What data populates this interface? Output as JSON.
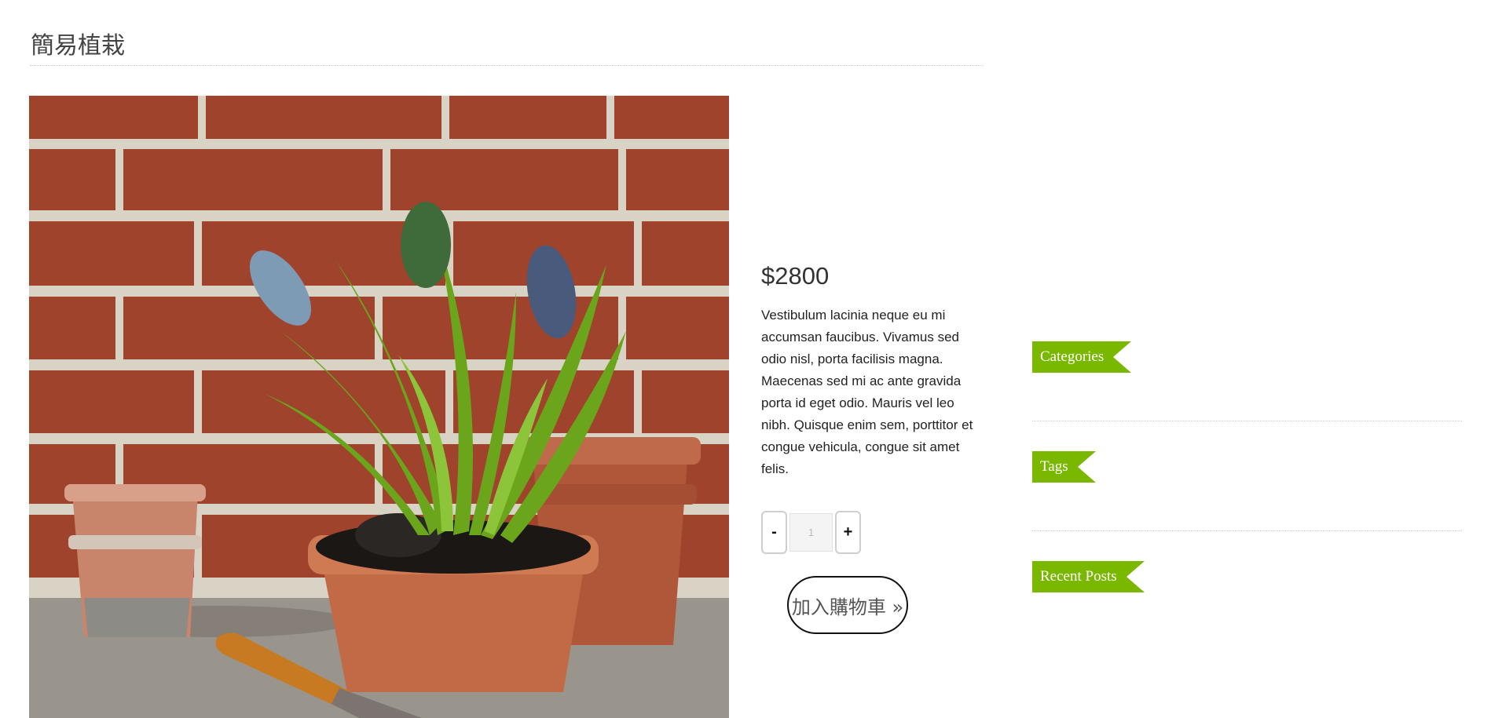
{
  "product": {
    "title": "簡易植栽",
    "image_description_icon": "potted-hyacinth-photo",
    "price": "$2800",
    "description": "Vestibulum lacinia neque eu mi accumsan faucibus. Vivamus sed odio nisl, porta facilisis magna. Maecenas sed mi ac ante gravida porta id eget odio. Mauris vel leo nibh. Quisque enim sem, porttitor et congue vehicula, congue sit amet felis.",
    "quantity": {
      "minus_label": "-",
      "plus_label": "+",
      "value": "1"
    },
    "add_to_cart_label": "加入購物車 »"
  },
  "sidebar": {
    "widgets": [
      {
        "title": "Categories"
      },
      {
        "title": "Tags"
      },
      {
        "title": "Recent Posts"
      }
    ]
  },
  "colors": {
    "accent": "#7ab800",
    "divider": "#cccccc"
  }
}
